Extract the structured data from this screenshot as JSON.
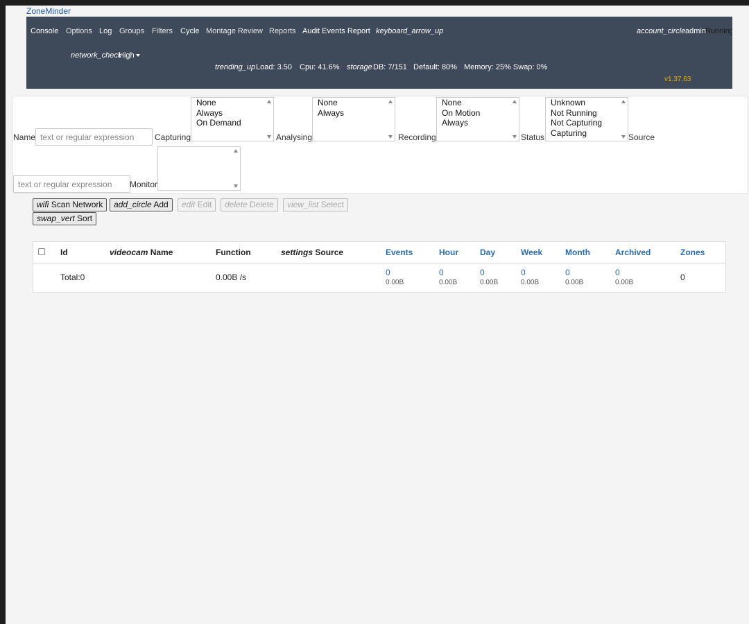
{
  "app": {
    "name": "ZoneMinder",
    "version": "v1.37.63"
  },
  "nav": {
    "items": [
      "Console",
      "Options",
      "Log",
      "Groups",
      "Filters",
      "Cycle",
      "Montage Review",
      "Reports",
      "Audit Events Report"
    ],
    "collapse_icon_text": "keyboard_arrow_up",
    "account_icon_text": "account_circle",
    "user": "admin",
    "run_state": "Running",
    "bandwidth_icon_text": "network_check",
    "bandwidth": "High",
    "load_icon_text": "trending_up",
    "load": "Load: 3.50",
    "cpu": "Cpu: 41.6%",
    "storage_icon_text": "storage",
    "db": "DB: 7/151",
    "default_storage": "Default: 80%",
    "memory": "Memory: 25% Swap: 0%"
  },
  "filters": {
    "name_label": "Name",
    "name_placeholder": "text or regular expression",
    "capturing_label": "Capturing",
    "capturing_options": [
      "None",
      "Always",
      "On Demand"
    ],
    "analysing_label": "Analysing",
    "analysing_options": [
      "None",
      "Always"
    ],
    "recording_label": "Recording",
    "recording_options": [
      "None",
      "On Motion",
      "Always"
    ],
    "status_label": "Status",
    "status_options": [
      "Unknown",
      "Not Running",
      "Not Capturing",
      "Capturing"
    ],
    "source_label": "Source",
    "source_placeholder": "text or regular expression",
    "monitor_label": "Monitor"
  },
  "toolbar": {
    "scan": {
      "icon": "wifi",
      "label": "Scan Network"
    },
    "add": {
      "icon": "add_circle",
      "label": "Add"
    },
    "edit": {
      "icon": "edit",
      "label": "Edit"
    },
    "delete": {
      "icon": "delete",
      "label": "Delete"
    },
    "select": {
      "icon": "view_list",
      "label": "Select"
    },
    "sort": {
      "icon": "swap_vert",
      "label": "Sort"
    }
  },
  "table": {
    "headers": {
      "id": "Id",
      "name_icon": "videocam",
      "name": "Name",
      "function": "Function",
      "source_icon": "settings",
      "source": "Source",
      "events": "Events",
      "hour": "Hour",
      "day": "Day",
      "week": "Week",
      "month": "Month",
      "archived": "Archived",
      "zones": "Zones"
    },
    "total": {
      "label": "Total:0",
      "function": "0.00B /s",
      "events": {
        "count": "0",
        "size": "0.00B"
      },
      "hour": {
        "count": "0",
        "size": "0.00B"
      },
      "day": {
        "count": "0",
        "size": "0.00B"
      },
      "week": {
        "count": "0",
        "size": "0.00B"
      },
      "month": {
        "count": "0",
        "size": "0.00B"
      },
      "archived": {
        "count": "0",
        "size": "0.00B"
      },
      "zones": "0"
    }
  },
  "colors": {
    "navbar": "#3e4a59",
    "version": "#f0b000",
    "link": "#2a6bb5"
  }
}
